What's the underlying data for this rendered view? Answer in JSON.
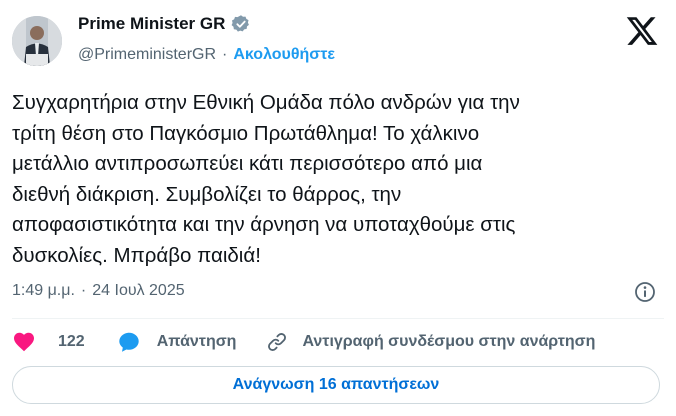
{
  "author": {
    "display_name": "Prime Minister GR",
    "handle": "@PrimeministerGR",
    "separator": "·",
    "follow_label": "Ακολουθήστε"
  },
  "post": {
    "text": "Συγχαρητήρια στην Εθνική Ομάδα πόλο ανδρών για την\nτρίτη θέση στο Παγκόσμιο Πρωτάθλημα! Το χάλκινο\nμετάλλιο αντιπροσωπεύει κάτι περισσότερο από μια\nδιεθνή διάκριση. Συμβολίζει το θάρρος, την\nαποφασιστικότητα και την άρνηση να υποταχθούμε στις\nδυσκολίες. Μπράβο παιδιά!",
    "time": "1:49 μ.μ.",
    "separator": "·",
    "date": "24 Ιουλ 2025"
  },
  "actions": {
    "likes_count": "122",
    "reply_label": "Απάντηση",
    "copy_link_label": "Αντιγραφή συνδέσμου στην ανάρτηση"
  },
  "read_replies_label": "Ανάγνωση 16 απαντήσεων",
  "colors": {
    "accent": "#1d9bf0",
    "like": "#f91880",
    "muted": "#536471",
    "verified": "#829aab"
  },
  "icons": [
    "verified-badge-icon",
    "x-logo-icon",
    "info-icon",
    "heart-icon",
    "reply-bubble-icon",
    "link-icon"
  ]
}
